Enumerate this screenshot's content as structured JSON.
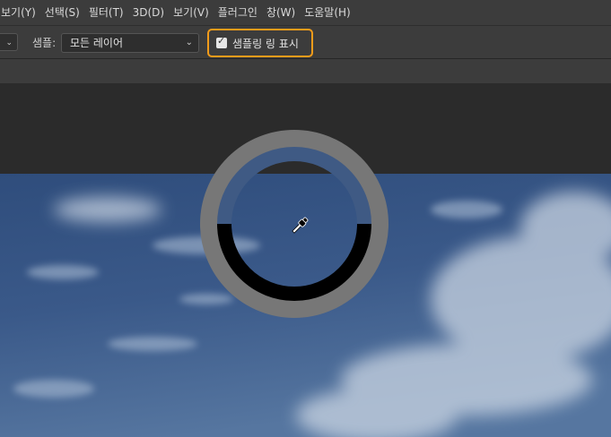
{
  "menu": [
    "보기(Y)",
    "선택(S)",
    "필터(T)",
    "3D(D)",
    "보기(V)",
    "플러그인",
    "창(W)",
    "도움말(H)"
  ],
  "options": {
    "sample_label": "샘플:",
    "sample_value": "모든 레이어",
    "show_ring_label": "샘플링 링 표시",
    "show_ring_checked": true
  },
  "colors": {
    "highlight": "#f39c1a",
    "ring_outer": "#777777",
    "sampled_new": "#3f5a84",
    "sampled_current": "#000000"
  }
}
